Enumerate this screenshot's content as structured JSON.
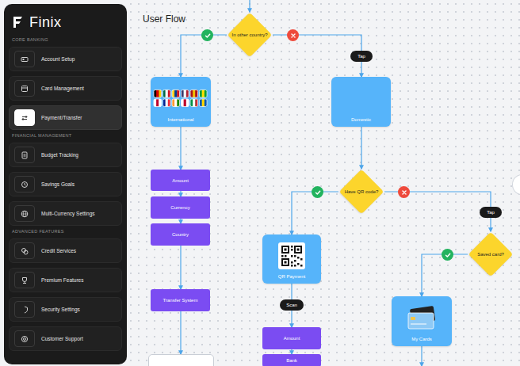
{
  "logo": {
    "text": "Finix"
  },
  "sidebar": {
    "sections": [
      {
        "title": "CORE BANKING",
        "items": [
          {
            "label": "Account Setup",
            "selected": false
          },
          {
            "label": "Card Management",
            "selected": false
          },
          {
            "label": "Payment/Transfer",
            "selected": true
          }
        ]
      },
      {
        "title": "FINANCIAL MANAGEMENT",
        "items": [
          {
            "label": "Budget Tracking",
            "selected": false
          },
          {
            "label": "Savings Goals",
            "selected": false
          },
          {
            "label": "Multi-Currency Settings",
            "selected": false
          }
        ]
      },
      {
        "title": "ADVANCED FEATURES",
        "items": [
          {
            "label": "Credit Services",
            "selected": false
          },
          {
            "label": "Premium Features",
            "selected": false
          },
          {
            "label": "Security Settings",
            "selected": false
          },
          {
            "label": "Customer Support",
            "selected": false
          }
        ]
      }
    ]
  },
  "canvas": {
    "title": "User Flow",
    "nodes": [
      {
        "kind": "decision",
        "text": "In other country?"
      },
      {
        "kind": "card",
        "text": "International"
      },
      {
        "kind": "card",
        "text": "Domestic"
      },
      {
        "kind": "step",
        "text": "Amount"
      },
      {
        "kind": "step",
        "text": "Currency"
      },
      {
        "kind": "step",
        "text": "Country"
      },
      {
        "kind": "step",
        "text": "Transfer System"
      },
      {
        "kind": "blank"
      },
      {
        "kind": "decision",
        "text": "Have QR code?"
      },
      {
        "kind": "card",
        "text": "QR Payment"
      },
      {
        "kind": "step",
        "text": "Amount"
      },
      {
        "kind": "step",
        "text": "Bank"
      },
      {
        "kind": "decision",
        "text": "Saved card?"
      },
      {
        "kind": "card",
        "text": "My Cards"
      },
      {
        "kind": "pill",
        "text": "Tap"
      },
      {
        "kind": "pill",
        "text": "Tap"
      },
      {
        "kind": "pill",
        "text": "Scan"
      },
      {
        "kind": "yes"
      },
      {
        "kind": "no"
      },
      {
        "kind": "yes"
      },
      {
        "kind": "no"
      },
      {
        "kind": "yes"
      }
    ]
  }
}
